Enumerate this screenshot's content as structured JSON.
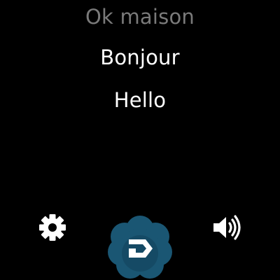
{
  "screen": {
    "conversation": {
      "previous_phrase": "Ok maison",
      "phrases": [
        "Bonjour",
        "Hello"
      ]
    }
  },
  "toolbar": {
    "left_icon": "gear-icon",
    "center_icon": "snips-logo-icon",
    "right_icon": "speaker-volume-icon"
  },
  "colors": {
    "background": "#000000",
    "text_primary": "#ffffff",
    "text_muted": "#7a7a7a",
    "logo_blob": "#1a5673",
    "logo_blob_dark": "#12415a",
    "logo_mark": "#ffffff"
  }
}
